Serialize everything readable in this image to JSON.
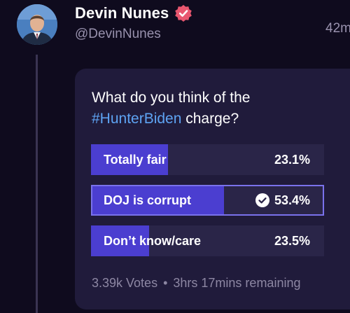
{
  "post": {
    "author_name": "Devin Nunes",
    "handle": "@DevinNunes",
    "timestamp": "42m",
    "verified_badge_color": "#e8566f"
  },
  "poll": {
    "question_prefix": "What do you think of the",
    "question_hashtag": "#HunterBiden",
    "question_suffix": " charge?",
    "options": [
      {
        "label": "Totally fair",
        "percent_text": "23.1%",
        "percent": 23.1,
        "selected": false
      },
      {
        "label": "DOJ is corrupt",
        "percent_text": "53.4%",
        "percent": 53.4,
        "selected": true
      },
      {
        "label": "Don’t know/care",
        "percent_text": "23.5%",
        "percent": 23.5,
        "selected": false
      }
    ],
    "votes": "3.39k Votes",
    "separator": "•",
    "time_remaining": "3hrs 17mins remaining"
  },
  "colors": {
    "background": "#0f0b1e",
    "card": "#201b3b",
    "bar_fill": "#4b3ed0",
    "selected_border": "#7a72ec",
    "hashtag": "#5ea3f3"
  }
}
